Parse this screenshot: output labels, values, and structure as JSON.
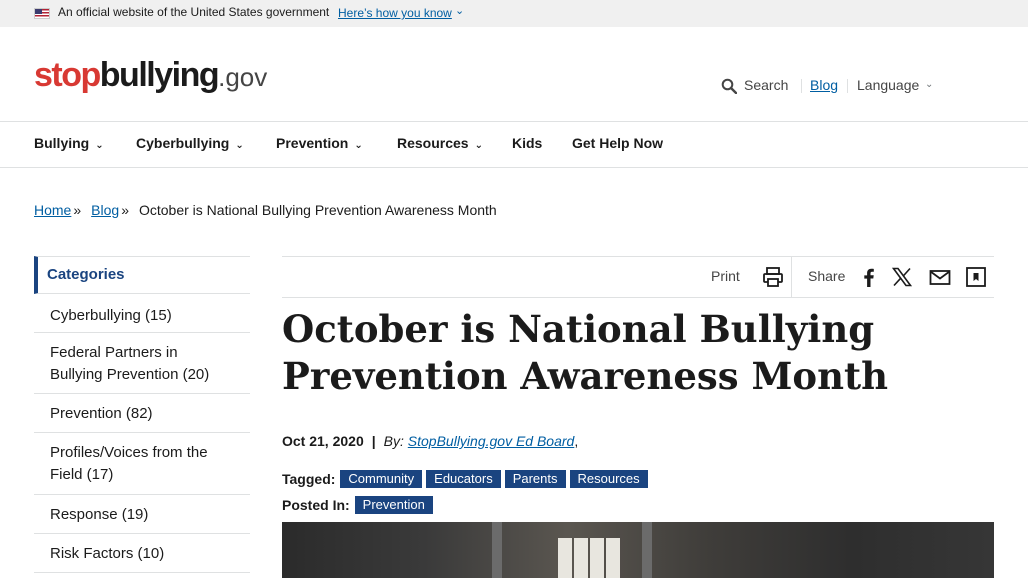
{
  "gov_banner": {
    "text": "An official website of the United States government",
    "link": "Here’s how you know"
  },
  "header": {
    "logo": {
      "stop": "stop",
      "bullying": "bullying",
      "gov": ".gov"
    },
    "search_label": "Search",
    "blog_label": "Blog",
    "language_label": "Language"
  },
  "nav": {
    "items": [
      {
        "label": "Bullying"
      },
      {
        "label": "Cyberbullying"
      },
      {
        "label": "Prevention"
      },
      {
        "label": "Resources"
      },
      {
        "label": "Kids"
      },
      {
        "label": "Get Help Now"
      }
    ]
  },
  "breadcrumb": {
    "home": "Home",
    "blog": "Blog",
    "separator": "»",
    "current": "October is National Bullying Prevention Awareness Month"
  },
  "sidebar": {
    "heading": "Categories",
    "items": [
      {
        "label": "Cyberbullying (15)"
      },
      {
        "label": "Federal Partners in Bullying Prevention (20)"
      },
      {
        "label": "Prevention (82)"
      },
      {
        "label": "Profiles/Voices from the Field (17)"
      },
      {
        "label": "Response (19)"
      },
      {
        "label": "Risk Factors (10)"
      }
    ]
  },
  "toolbar": {
    "print_label": "Print",
    "share_label": "Share",
    "icons": [
      "print-icon",
      "facebook-icon",
      "x-icon",
      "email-icon",
      "bookmark-icon"
    ]
  },
  "article": {
    "title": "October is National Bullying Prevention Awareness Month",
    "date": "Oct 21, 2020",
    "pipe": "|",
    "by": "By:",
    "author": "StopBullying.gov Ed Board",
    "author_suffix": ",",
    "tagged_label": "Tagged:",
    "tags": [
      "Community",
      "Educators",
      "Parents",
      "Resources"
    ],
    "posted_label": "Posted In:",
    "posted_in": [
      "Prevention"
    ]
  },
  "colors": {
    "link": "#005ea2",
    "accent": "#1a4480",
    "logo_red": "#d83933"
  }
}
